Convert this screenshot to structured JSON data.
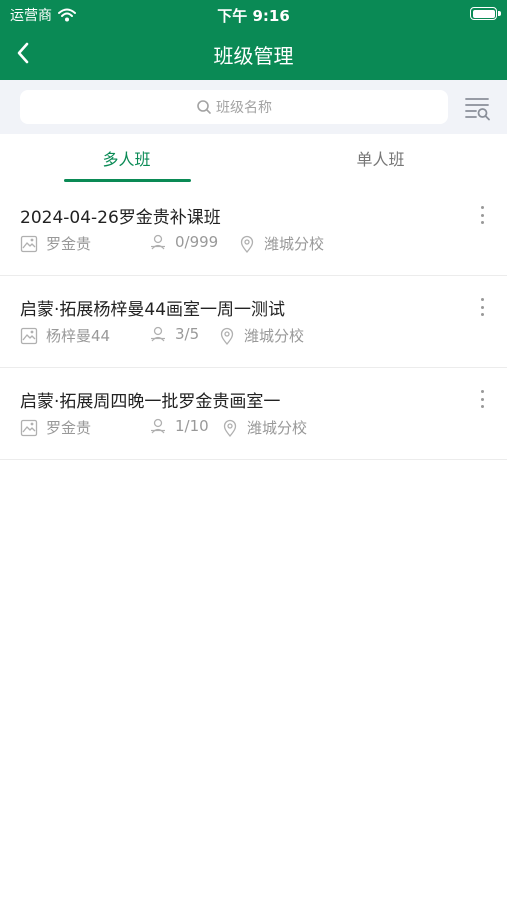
{
  "status_bar": {
    "carrier": "运营商",
    "time": "下午 9:16"
  },
  "nav": {
    "title": "班级管理",
    "back_icon": "chevron-left-icon"
  },
  "search": {
    "placeholder": "班级名称",
    "filter_icon": "filter-search-icon"
  },
  "tabs": [
    {
      "label": "多人班",
      "active": true
    },
    {
      "label": "单人班",
      "active": false
    }
  ],
  "colors": {
    "brand": "#0a8a55",
    "search_bg": "#f1f3f8",
    "meta_text": "#999999"
  },
  "classes": [
    {
      "name": "2024-04-26罗金贵补课班",
      "teacher": "罗金贵",
      "count": "0/999",
      "campus": "潍城分校"
    },
    {
      "name": "启蒙·拓展杨梓曼44画室一周一测试",
      "teacher": "杨梓曼44",
      "count": "3/5",
      "campus": "潍城分校"
    },
    {
      "name": "启蒙·拓展周四晚一批罗金贵画室一",
      "teacher": "罗金贵",
      "count": "1/10",
      "campus": "潍城分校"
    }
  ]
}
